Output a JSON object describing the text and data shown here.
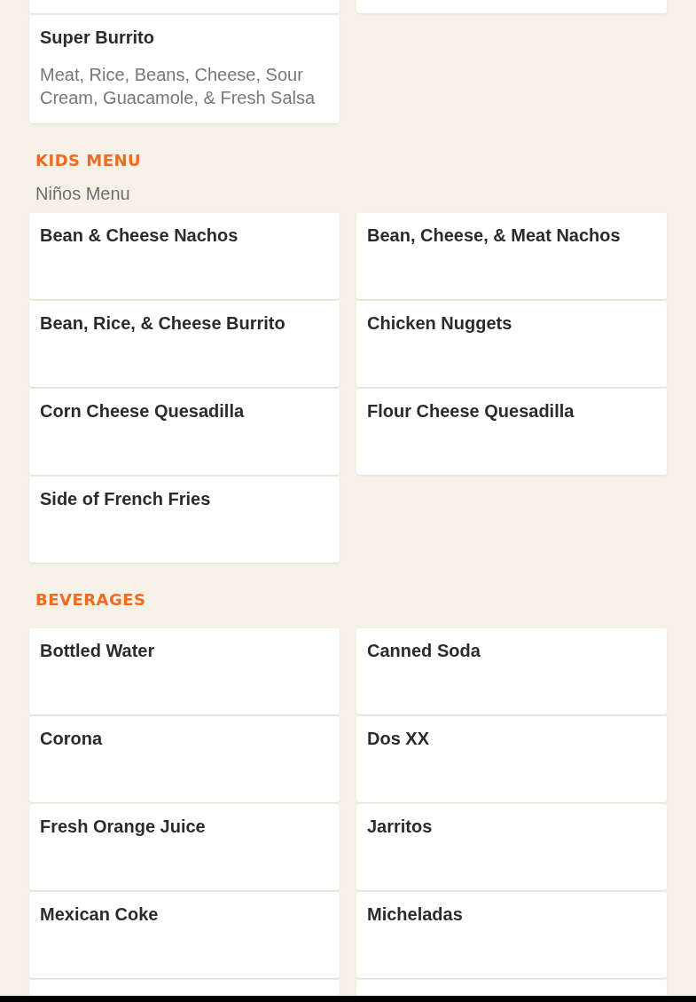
{
  "sections": [
    {
      "items": [
        {
          "name": "Super Burrito",
          "description": "Meat, Rice, Beans, Cheese, Sour Cream, Guacamole, & Fresh Salsa"
        }
      ]
    },
    {
      "title": "KIDS MENU",
      "subtitle": "Niños Menu",
      "items": [
        {
          "name": "Bean & Cheese Nachos"
        },
        {
          "name": "Bean, Cheese, & Meat Nachos"
        },
        {
          "name": "Bean, Rice, & Cheese Burrito"
        },
        {
          "name": "Chicken Nuggets"
        },
        {
          "name": "Corn Cheese Quesadilla"
        },
        {
          "name": "Flour Cheese Quesadilla"
        },
        {
          "name": "Side of French Fries"
        }
      ]
    },
    {
      "title": "BEVERAGES",
      "items": [
        {
          "name": "Bottled Water"
        },
        {
          "name": "Canned Soda"
        },
        {
          "name": "Corona"
        },
        {
          "name": "Dos XX"
        },
        {
          "name": "Fresh Orange Juice"
        },
        {
          "name": "Jarritos"
        },
        {
          "name": "Mexican Coke"
        },
        {
          "name": "Micheladas"
        }
      ]
    }
  ]
}
